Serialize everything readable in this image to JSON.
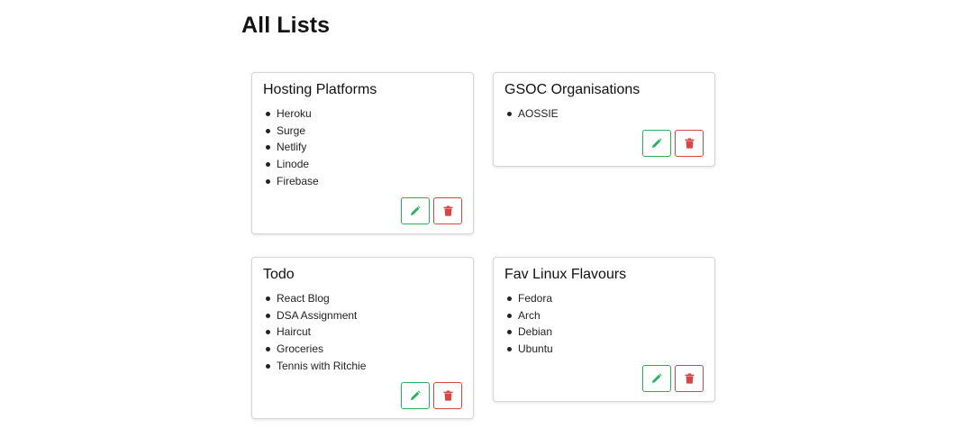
{
  "page": {
    "title": "All Lists"
  },
  "lists": [
    {
      "title": "Hosting Platforms",
      "items": [
        "Heroku",
        "Surge",
        "Netlify",
        "Linode",
        "Firebase"
      ]
    },
    {
      "title": "GSOC Organisations",
      "items": [
        "AOSSIE"
      ]
    },
    {
      "title": "Todo",
      "items": [
        "React Blog",
        "DSA Assignment",
        "Haircut",
        "Groceries",
        "Tennis with Ritchie"
      ]
    },
    {
      "title": "Fav Linux Flavours",
      "items": [
        "Fedora",
        "Arch",
        "Debian",
        "Ubuntu"
      ]
    }
  ],
  "icons": {
    "edit": "pencil-icon",
    "delete": "trash-icon"
  },
  "colors": {
    "edit": "#28b05a",
    "delete": "#d84545"
  }
}
